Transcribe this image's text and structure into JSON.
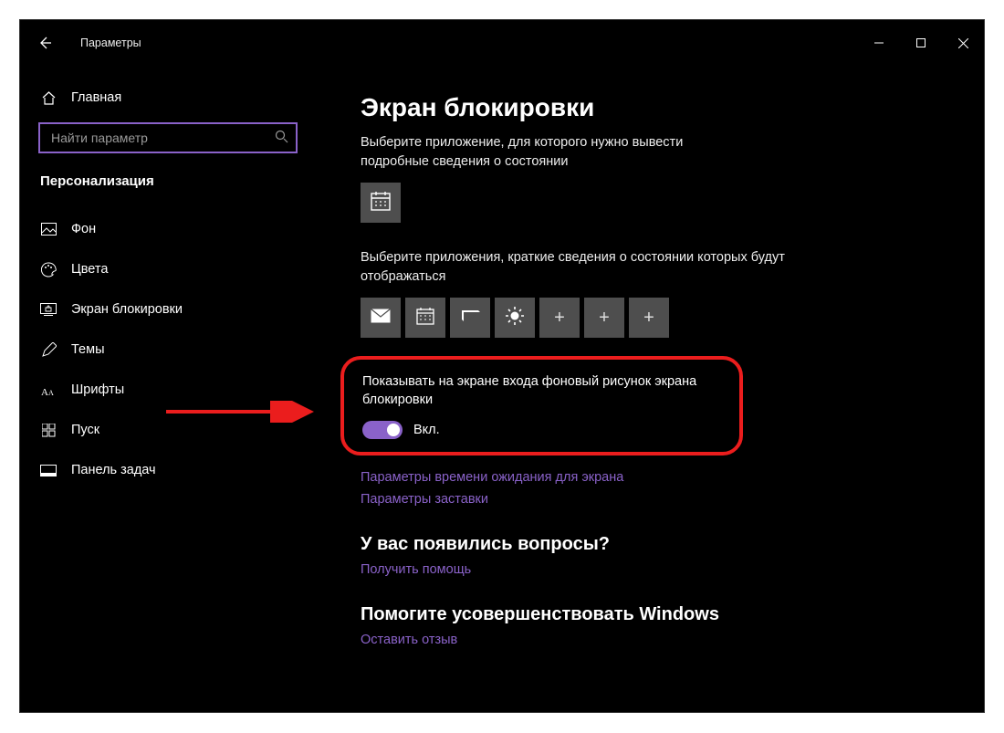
{
  "window": {
    "app_title": "Параметры"
  },
  "sidebar": {
    "home": "Главная",
    "search_placeholder": "Найти параметр",
    "category": "Персонализация",
    "items": [
      {
        "label": "Фон"
      },
      {
        "label": "Цвета"
      },
      {
        "label": "Экран блокировки"
      },
      {
        "label": "Темы"
      },
      {
        "label": "Шрифты"
      },
      {
        "label": "Пуск"
      },
      {
        "label": "Панель задач"
      }
    ]
  },
  "content": {
    "page_title": "Экран блокировки",
    "detail_app_label": "Выберите приложение, для которого нужно вывести подробные сведения о состоянии",
    "quick_apps_label": "Выберите приложения, краткие сведения о состоянии которых будут отображаться",
    "show_bg_label": "Показывать на экране входа фоновый рисунок экрана блокировки",
    "toggle_state": "Вкл.",
    "link_timeout": "Параметры времени ожидания для экрана",
    "link_screensaver": "Параметры заставки",
    "help_heading": "У вас появились вопросы?",
    "help_link": "Получить помощь",
    "feedback_heading": "Помогите усовершенствовать Windows",
    "feedback_link": "Оставить отзыв"
  },
  "colors": {
    "accent": "#8a62c9",
    "highlight": "#eb1d1d",
    "tile_bg": "#4e4e4e"
  }
}
